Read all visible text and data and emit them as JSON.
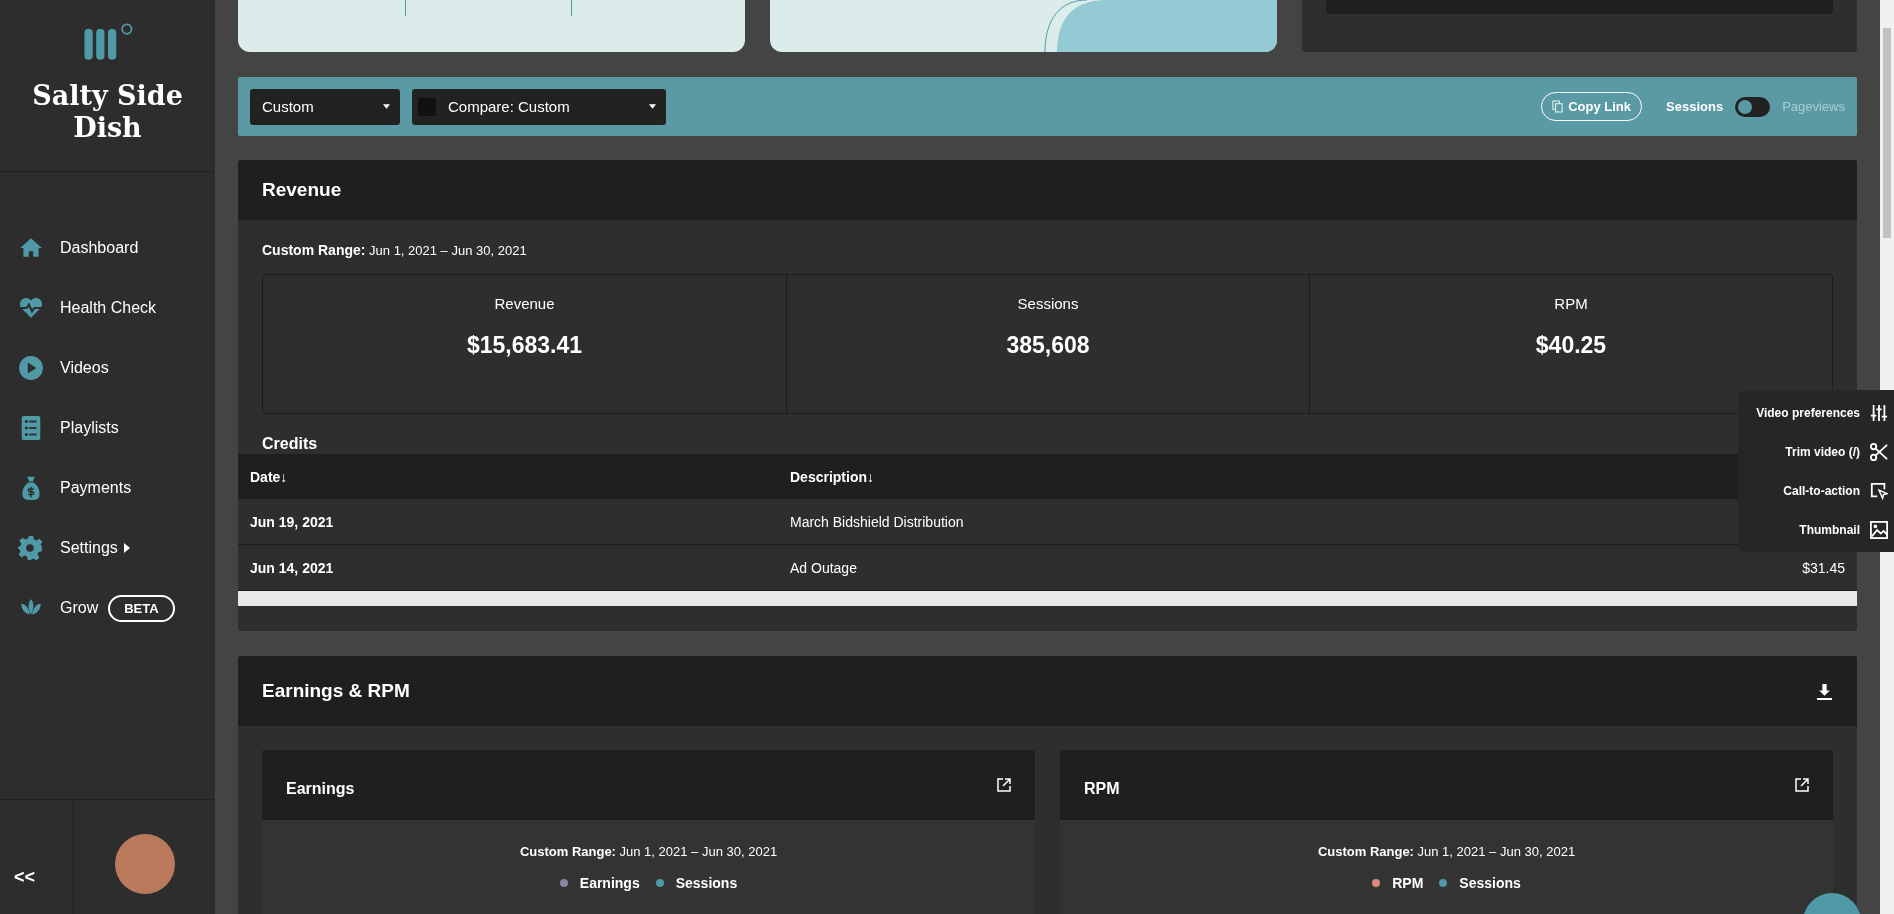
{
  "sidebar": {
    "brand": "Salty Side Dish",
    "items": [
      {
        "label": "Dashboard",
        "has_submenu": false
      },
      {
        "label": "Health Check",
        "has_submenu": false
      },
      {
        "label": "Videos",
        "has_submenu": false
      },
      {
        "label": "Playlists",
        "has_submenu": false
      },
      {
        "label": "Payments",
        "has_submenu": false
      },
      {
        "label": "Settings",
        "has_submenu": true
      },
      {
        "label": "Grow",
        "has_submenu": false,
        "badge": "BETA"
      }
    ],
    "collapse": "<<"
  },
  "filter_bar": {
    "range_select": "Custom",
    "compare_select": "Compare: Custom",
    "copy_link": "Copy Link",
    "toggle": {
      "left_label": "Sessions",
      "right_label": "Pageviews",
      "on": false
    }
  },
  "revenue": {
    "title": "Revenue",
    "range_label": "Custom Range:",
    "range_value": "Jun 1, 2021 – Jun 30, 2021",
    "stats": [
      {
        "label": "Revenue",
        "value": "$15,683.41"
      },
      {
        "label": "Sessions",
        "value": "385,608"
      },
      {
        "label": "RPM",
        "value": "$40.25"
      }
    ],
    "credits": {
      "title": "Credits",
      "columns": [
        "Date↓",
        "Description↓"
      ],
      "rows": [
        {
          "date": "Jun 19, 2021",
          "description": "March Bidshield Distribution"
        },
        {
          "date": "Jun 14, 2021",
          "description": "Ad Outage",
          "amount": "$31.45"
        }
      ]
    }
  },
  "earnings_rpm": {
    "title": "Earnings & RPM",
    "panels": [
      {
        "title": "Earnings",
        "range_label": "Custom Range:",
        "range_value": "Jun 1, 2021 – Jun 30, 2021",
        "legend": [
          {
            "label": "Earnings",
            "color": "#8a87a6"
          },
          {
            "label": "Sessions",
            "color": "#4f9aa6"
          }
        ]
      },
      {
        "title": "RPM",
        "range_label": "Custom Range:",
        "range_value": "Jun 1, 2021 – Jun 30, 2021",
        "legend": [
          {
            "label": "RPM",
            "color": "#e0867a"
          },
          {
            "label": "Sessions",
            "color": "#4f9aa6"
          }
        ]
      }
    ]
  },
  "video_menu": {
    "items": [
      "Video preferences",
      "Trim video (/)",
      "Call-to-action",
      "Thumbnail"
    ]
  }
}
